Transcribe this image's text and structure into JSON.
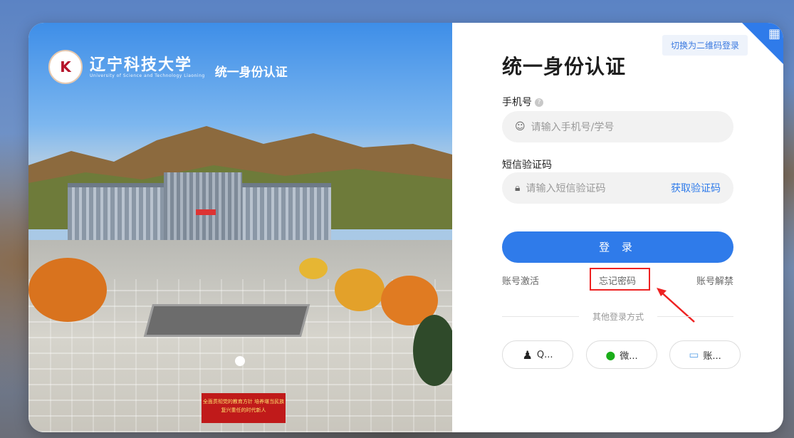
{
  "brand": {
    "name_cn": "辽宁科技大学",
    "name_en": "University of Science and Technology Liaoning",
    "subtitle": "统一身份认证"
  },
  "photo": {
    "banner_text": "全面贯彻党的教育方针 培养堪当民族复兴重任的时代新人"
  },
  "qr_switch": {
    "label": "切换为二维码登录"
  },
  "form": {
    "title": "统一身份认证",
    "phone_label": "手机号",
    "phone_placeholder": "请输入手机号/学号",
    "code_label": "短信验证码",
    "code_placeholder": "请输入短信验证码",
    "get_code": "获取验证码",
    "login": "登 录"
  },
  "links": {
    "activate": "账号激活",
    "forgot": "忘记密码",
    "unban": "账号解禁"
  },
  "other": {
    "label": "其他登录方式",
    "options": [
      {
        "label": "Q...",
        "icon": "qq-icon"
      },
      {
        "label": "微...",
        "icon": "wechat-icon"
      },
      {
        "label": "账...",
        "icon": "account-icon"
      }
    ]
  },
  "colors": {
    "accent": "#2f7bea",
    "highlight": "#e22222"
  }
}
